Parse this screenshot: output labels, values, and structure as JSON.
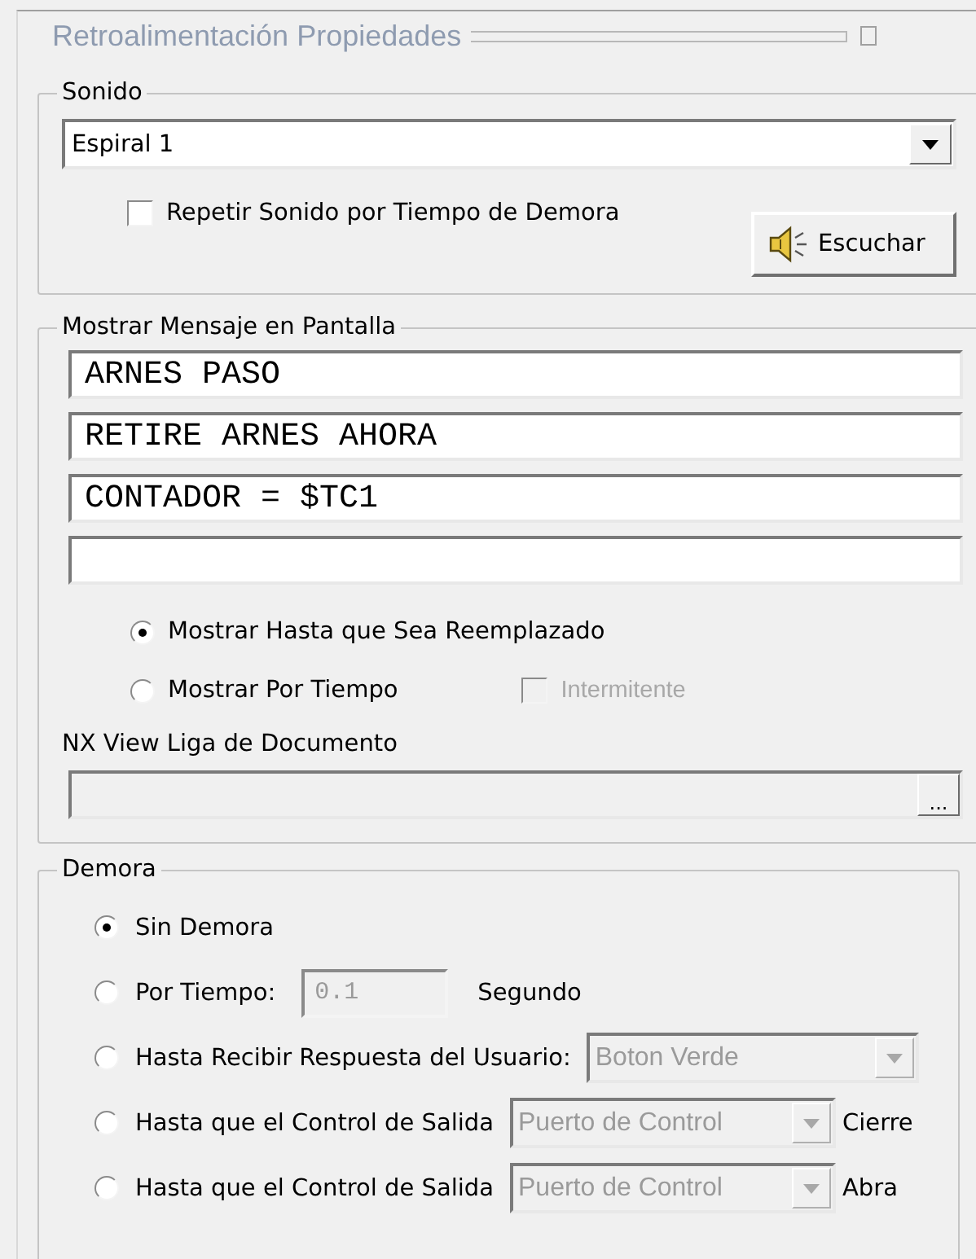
{
  "panel": {
    "title": "Retroalimentación Propiedades"
  },
  "sound": {
    "legend": "Sonido",
    "select": {
      "value": "Espiral 1"
    },
    "repeat": {
      "label": "Repetir Sonido por Tiempo de Demora",
      "checked": false
    },
    "listen_button": "Escuchar"
  },
  "message": {
    "legend": "Mostrar Mensaje en Pantalla",
    "lines": [
      {
        "kind": "text",
        "value": "ARNES PASO"
      },
      {
        "kind": "text",
        "value": "RETIRE ARNES AHORA"
      },
      {
        "kind": "text",
        "value": "CONTADOR = $TC1"
      },
      {
        "kind": "blank"
      }
    ],
    "display_options": [
      {
        "label": "Mostrar Hasta que Sea Reemplazado",
        "selected": true
      },
      {
        "label": "Mostrar Por Tiempo",
        "selected": false
      }
    ],
    "blink": {
      "label": "Intermitente",
      "checked": false,
      "disabled": true
    },
    "document_link": {
      "label": "NX View Liga de Documento",
      "browse_button": "...",
      "disabled": true
    }
  },
  "delay": {
    "legend": "Demora",
    "options": [
      {
        "kind": "plain",
        "label": "Sin Demora",
        "selected": true
      },
      {
        "kind": "time",
        "label": "Por Tiempo:",
        "value": "0.1",
        "unit": "Segundo",
        "selected": false,
        "disabled": true
      },
      {
        "kind": "select",
        "label": "Hasta Recibir Respuesta del Usuario:",
        "value": "Boton Verde",
        "selected": false,
        "disabled": true
      },
      {
        "kind": "select",
        "label": "Hasta que el Control de Salida",
        "value": "Puerto de Control",
        "suffix": "Cierre",
        "selected": false,
        "disabled": true
      },
      {
        "kind": "select",
        "label": "Hasta que el Control de Salida",
        "value": "Puerto de Control",
        "suffix": "Abra",
        "selected": false,
        "disabled": true
      }
    ]
  }
}
